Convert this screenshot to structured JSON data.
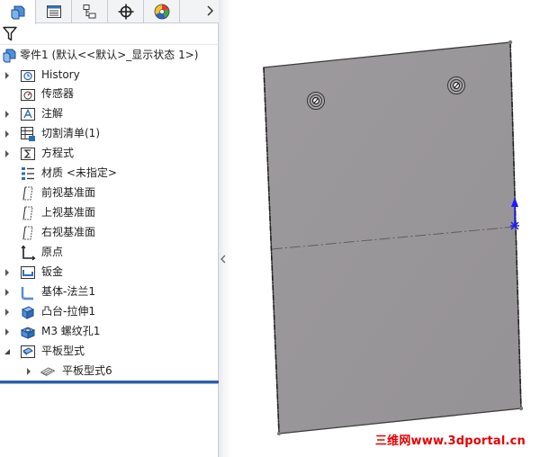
{
  "tabs": [
    {
      "name": "featuremanager-tab",
      "icon": "feature-tree-icon",
      "active": true
    },
    {
      "name": "propertymanager-tab",
      "icon": "property-list-icon",
      "active": false
    },
    {
      "name": "configurationmanager-tab",
      "icon": "configuration-icon",
      "active": false
    },
    {
      "name": "dimxpert-tab",
      "icon": "crosshair-icon",
      "active": false
    },
    {
      "name": "display-manager-tab",
      "icon": "color-wheel-icon",
      "active": false
    }
  ],
  "tabs_more_icon": "chevron-right-icon",
  "filter": {
    "icon": "filter-icon",
    "value": ""
  },
  "tree": {
    "root": {
      "label": "零件1 (默认<<默认>_显示状态 1>)",
      "icon": "part-icon"
    },
    "items": [
      {
        "label": "History",
        "icon": "history-folder-icon",
        "expandable": true
      },
      {
        "label": "传感器",
        "icon": "sensors-icon",
        "expandable": false
      },
      {
        "label": "注解",
        "icon": "annotations-icon",
        "expandable": true
      },
      {
        "label": "切割清单(1)",
        "icon": "cut-list-icon",
        "expandable": true
      },
      {
        "label": "方程式",
        "icon": "equations-icon",
        "expandable": true
      },
      {
        "label": "材质 <未指定>",
        "icon": "material-icon",
        "expandable": false
      },
      {
        "label": "前视基准面",
        "icon": "plane-icon",
        "expandable": false
      },
      {
        "label": "上视基准面",
        "icon": "plane-icon",
        "expandable": false
      },
      {
        "label": "右视基准面",
        "icon": "plane-icon",
        "expandable": false
      },
      {
        "label": "原点",
        "icon": "origin-icon",
        "expandable": false
      },
      {
        "label": "钣金",
        "icon": "sheet-metal-icon",
        "expandable": true
      },
      {
        "label": "基体-法兰1",
        "icon": "base-flange-icon",
        "expandable": true
      },
      {
        "label": "凸台-拉伸1",
        "icon": "boss-extrude-icon",
        "expandable": true
      },
      {
        "label": "M3 螺纹孔1",
        "icon": "hole-wizard-icon",
        "expandable": true
      },
      {
        "label": "平板型式",
        "icon": "flat-pattern-folder-icon",
        "expandable": true,
        "expanded": true
      },
      {
        "label": "平板型式6",
        "icon": "flat-pattern-icon",
        "expandable": true,
        "child": true
      }
    ]
  },
  "viewport": {
    "part_color": "#999699",
    "triad_color": "#1a1aff",
    "watermark": "三维网www.3dportal.cn"
  },
  "colors": {
    "accent": "#2c5fa8",
    "icon_blue": "#2f6db5",
    "watermark": "#e60000"
  }
}
